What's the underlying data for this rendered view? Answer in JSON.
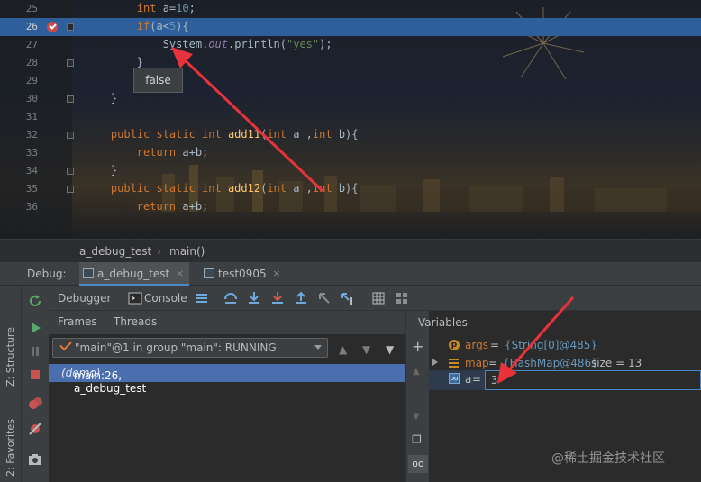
{
  "editor": {
    "lines": [
      {
        "num": "25",
        "tokens": [
          {
            "t": "        "
          },
          {
            "t": "int",
            "c": "kw"
          },
          {
            "t": " a="
          },
          {
            "t": "10",
            "c": "num"
          },
          {
            "t": ";"
          }
        ]
      },
      {
        "num": "26",
        "tokens": [
          {
            "t": "        "
          },
          {
            "t": "if",
            "c": "kw"
          },
          {
            "t": "(a<"
          },
          {
            "t": "5",
            "c": "num"
          },
          {
            "t": "){"
          }
        ]
      },
      {
        "num": "27",
        "tokens": [
          {
            "t": "            Sy"
          },
          {
            "t": "stem.",
            "c": ""
          },
          {
            "t": "out",
            "c": "it"
          },
          {
            "t": ".println("
          },
          {
            "t": "\"yes\"",
            "c": "str"
          },
          {
            "t": ");"
          }
        ]
      },
      {
        "num": "28",
        "tokens": [
          {
            "t": "        }"
          }
        ]
      },
      {
        "num": "29",
        "tokens": []
      },
      {
        "num": "30",
        "tokens": [
          {
            "t": "    }"
          }
        ]
      },
      {
        "num": "31",
        "tokens": []
      },
      {
        "num": "32",
        "tokens": [
          {
            "t": "    "
          },
          {
            "t": "public static int ",
            "c": "kw"
          },
          {
            "t": "add11",
            "c": "fn"
          },
          {
            "t": "("
          },
          {
            "t": "int",
            "c": "kw"
          },
          {
            "t": " a ,"
          },
          {
            "t": "int",
            "c": "kw"
          },
          {
            "t": " b){"
          }
        ]
      },
      {
        "num": "33",
        "tokens": [
          {
            "t": "        "
          },
          {
            "t": "return",
            "c": "kw"
          },
          {
            "t": " a+b;"
          }
        ]
      },
      {
        "num": "34",
        "tokens": [
          {
            "t": "    }"
          }
        ]
      },
      {
        "num": "35",
        "tokens": [
          {
            "t": "    "
          },
          {
            "t": "public static int ",
            "c": "kw"
          },
          {
            "t": "add12",
            "c": "fn"
          },
          {
            "t": "("
          },
          {
            "t": "int",
            "c": "kw"
          },
          {
            "t": " a ,"
          },
          {
            "t": "int",
            "c": "kw"
          },
          {
            "t": " b){"
          }
        ]
      },
      {
        "num": "36",
        "tokens": [
          {
            "t": "        "
          },
          {
            "t": "return",
            "c": "kw"
          },
          {
            "t": " a+b;"
          }
        ]
      }
    ],
    "highlighted_line": "26",
    "tooltip": "false"
  },
  "breadcrumb": {
    "file": "a_debug_test",
    "sep": "›",
    "method": "main()"
  },
  "debug": {
    "label": "Debug:",
    "tabs": [
      {
        "label": "a_debug_test",
        "close": "×"
      },
      {
        "label": "test0905",
        "close": "×"
      }
    ],
    "toolbar": {
      "debugger": "Debugger",
      "console": "Console"
    },
    "subtabs": {
      "frames": "Frames",
      "threads": "Threads"
    },
    "thread": "\"main\"@1 in group \"main\": RUNNING",
    "frame": {
      "location": "main:26, a_debug_test",
      "pkg": "(demo)"
    },
    "variables_title": "Variables",
    "variables": [
      {
        "name": "args",
        "eq": " = ",
        "value": "{String[0]@485}",
        "extra": ""
      },
      {
        "name": "map",
        "eq": " = ",
        "value": "{HashMap@486}",
        "extra": " size = 13"
      }
    ],
    "edit": {
      "name": "a",
      "eq": " = ",
      "value": "3",
      "icon": "oo"
    }
  },
  "side": {
    "structure": "Z: Structure",
    "favorites": "2: Favorites"
  },
  "watermark": "@稀土掘金技术社区",
  "colors": {
    "accent": "#4a88c7",
    "highlight": "#2f5f9a",
    "arrow": "#e8323c"
  }
}
